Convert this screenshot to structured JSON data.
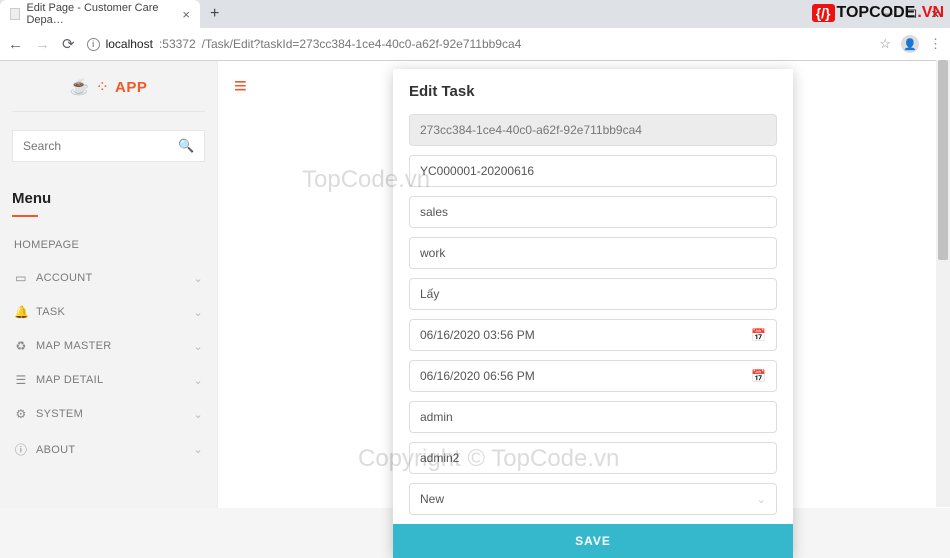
{
  "browser": {
    "tab_title": "Edit Page - Customer Care Depa…",
    "url_host": "localhost",
    "url_port": ":53372",
    "url_path": "/Task/Edit?taskId=273cc384-1ce4-40c0-a62f-92e711bb9ca4"
  },
  "app_name": "APP",
  "search_placeholder": "Search",
  "menu_title": "Menu",
  "menu": {
    "homepage": "HOMEPAGE",
    "account": "ACCOUNT",
    "task": "TASK",
    "map_master": "MAP MASTER",
    "map_detail": "MAP DETAIL",
    "system": "SYSTEM",
    "about": "ABOUT"
  },
  "card": {
    "title": "Edit Task",
    "task_id": "273cc384-1ce4-40c0-a62f-92e711bb9ca4",
    "code": "YC000001-20200616",
    "field3": "sales",
    "field4": "work",
    "field5": "Lấy",
    "start_dt": "06/16/2020 03:56 PM",
    "end_dt": "06/16/2020 06:56 PM",
    "user1": "admin",
    "user2": "admin2",
    "status": "New",
    "save_label": "SAVE"
  },
  "watermark1": "TopCode.vn",
  "watermark2": "Copyright © TopCode.vn",
  "topcode": {
    "brand": "TOPCODE",
    "suffix": ".VN"
  }
}
